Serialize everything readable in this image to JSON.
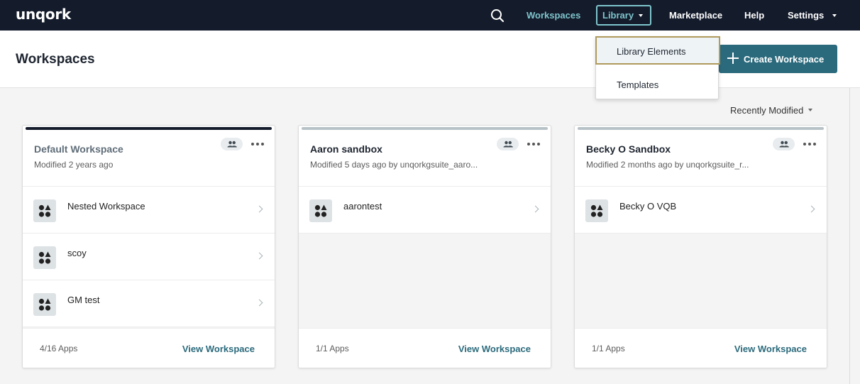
{
  "nav": {
    "logo": "unqork",
    "workspaces": "Workspaces",
    "library": "Library",
    "marketplace": "Marketplace",
    "help": "Help",
    "settings": "Settings"
  },
  "header": {
    "title": "Workspaces",
    "create_button": "Create Workspace"
  },
  "sort": {
    "label": "Recently Modified"
  },
  "library_dropdown": {
    "items": [
      "Library Elements",
      "Templates"
    ]
  },
  "cards": [
    {
      "title": "Default Workspace",
      "modified": "Modified 2 years ago",
      "apps": [
        "Nested Workspace",
        "scoy",
        "GM test"
      ],
      "apps_count": "4/16 Apps",
      "view_link": "View Workspace"
    },
    {
      "title": "Aaron sandbox",
      "modified": "Modified 5 days ago by unqorkgsuite_aaro...",
      "apps": [
        "aarontest"
      ],
      "apps_count": "1/1 Apps",
      "view_link": "View Workspace"
    },
    {
      "title": "Becky O Sandbox",
      "modified": "Modified 2 months ago by unqorkgsuite_r...",
      "apps": [
        "Becky O VQB"
      ],
      "apps_count": "1/1 Apps",
      "view_link": "View Workspace"
    }
  ],
  "colors": {
    "nav_bg": "#141b2b",
    "accent_teal": "#7ec5cc",
    "primary_button": "#2b6a7c",
    "focus_outline": "#b09a5c"
  },
  "icons": [
    "search-icon",
    "chevron-down-icon",
    "plus-icon",
    "people-icon",
    "more-icon",
    "app-shapes-icon",
    "chevron-right-icon"
  ]
}
